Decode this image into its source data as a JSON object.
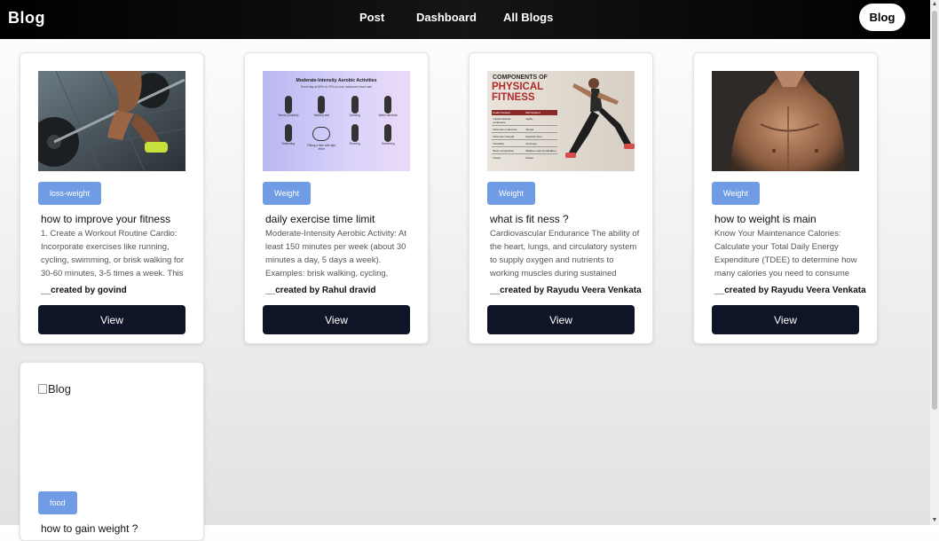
{
  "nav": {
    "brand": "Blog",
    "links": [
      "Post",
      "Dashboard",
      "All Blogs"
    ],
    "button": "Blog"
  },
  "cards": [
    {
      "tag": "loss-weight",
      "title": "how to improve your fitness",
      "body": "1. Create a Workout Routine Cardio: Incorporate exercises like running, cycling, swimming, or brisk walking for 30-60 minutes, 3-5 times a week. This",
      "author": "__created by govind",
      "view": "View"
    },
    {
      "tag": "Weight",
      "title": "daily exercise time limit",
      "body": "Moderate-Intensity Aerobic Activity: At least 150 minutes per week (about 30 minutes a day, 5 days a week). Examples: brisk walking, cycling,",
      "author": "__created by Rahul dravid",
      "view": "View",
      "image": {
        "title": "Moderate-Intensity Aerobic Activities",
        "subtitle": "Exert day at 60% to 70% of your maximum heart rate",
        "items": [
          "Tennis (doubles)",
          "Walking fast",
          "Dancing",
          "Water aerobics",
          "Swimming",
          "Riding a bike with light effort",
          "Running",
          "Gardening"
        ]
      }
    },
    {
      "tag": "Weight",
      "title": "what is fit ness ?",
      "body": "Cardiovascular Endurance The ability of the heart, lungs, and circulatory system to supply oxygen and nutrients to working muscles during sustained",
      "author": "__created by Rayudu Veera Venkata",
      "view": "View",
      "image": {
        "heading_small": "COMPONENTS OF",
        "heading_big": "PHYSICAL FITNESS",
        "col1": "Health Related",
        "col2": "Skill Related",
        "rows": [
          [
            "Cardiovascular endurance",
            "Agility"
          ],
          [
            "Muscular endurance",
            "Speed"
          ],
          [
            "Muscular strength",
            "Reaction time"
          ],
          [
            "Flexibility",
            "Accuracy"
          ],
          [
            "Body composition",
            "Balance and coordination"
          ],
          [
            "Power",
            "Power"
          ]
        ]
      }
    },
    {
      "tag": "Weight",
      "title": "how to weight is main",
      "body": "Know Your Maintenance Calories: Calculate your Total Daily Energy Expenditure (TDEE) to determine how many calories you need to consume",
      "author": "__created by Rayudu Veera Venkata",
      "view": "View"
    },
    {
      "tag": "food",
      "alt": "Blog",
      "title": "how to gain weight ?"
    }
  ],
  "colors": {
    "tag_bg": "#6f9ce5",
    "view_btn_bg": "#0f1427",
    "nav_bg": "#000000"
  }
}
